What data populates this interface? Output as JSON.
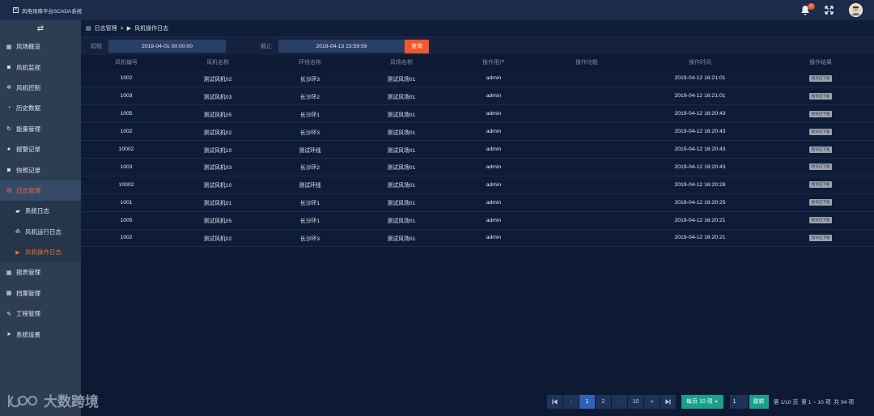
{
  "app": {
    "title": "风电场降平台SCADA系统",
    "notifications": "0"
  },
  "sidebar": {
    "items": [
      {
        "label": "风场概览",
        "icon": "grid-icon",
        "glyph": "▦"
      },
      {
        "label": "风机监视",
        "icon": "camera-icon",
        "glyph": "◙"
      },
      {
        "label": "风机控制",
        "icon": "gear-icon",
        "glyph": "✲"
      },
      {
        "label": "历史数据",
        "icon": "pie-icon",
        "glyph": "◔"
      },
      {
        "label": "能量管理",
        "icon": "refresh-icon",
        "glyph": "↻"
      },
      {
        "label": "报警记录",
        "icon": "bell-icon",
        "glyph": "♠"
      },
      {
        "label": "快照记录",
        "icon": "camera-icon",
        "glyph": "◙"
      },
      {
        "label": "日志管理",
        "icon": "calendar-icon",
        "glyph": "▤"
      }
    ],
    "sub_items": [
      {
        "label": "系统日志",
        "icon": "book-icon",
        "glyph": "▰"
      },
      {
        "label": "风机运行日志",
        "icon": "cubes-icon",
        "glyph": "⁂"
      },
      {
        "label": "风机操作日志",
        "icon": "play-icon",
        "glyph": "▶"
      }
    ],
    "items_after": [
      {
        "label": "报表管理",
        "icon": "grid-icon",
        "glyph": "▦"
      },
      {
        "label": "档案管理",
        "icon": "grid-icon",
        "glyph": "▦"
      },
      {
        "label": "工程管理",
        "icon": "wrench-icon",
        "glyph": "✎"
      },
      {
        "label": "系统设置",
        "icon": "send-icon",
        "glyph": "➤"
      }
    ]
  },
  "breadcrumb": {
    "root": "日志管理",
    "sep": ">",
    "current": "风机操作日志"
  },
  "filter": {
    "start_label": "起始",
    "start_value": "2019-04-01 00:00:00",
    "end_label": "截止",
    "end_value": "2019-04-13 23:59:59",
    "query_label": "查询"
  },
  "table": {
    "columns": [
      "风机编号",
      "风机名称",
      "环线名称",
      "风场名称",
      "操作用户",
      "操作功能",
      "操作时间",
      "操作结果"
    ],
    "rows": [
      [
        "1002",
        "测试风机02",
        "长沙环3",
        "测试风场01",
        "admin",
        "",
        "2019-04-12 16:21:01",
        "指令已下发"
      ],
      [
        "1003",
        "测试风机03",
        "长沙环2",
        "测试风场01",
        "admin",
        "",
        "2019-04-12 16:21:01",
        "指令已下发"
      ],
      [
        "1005",
        "测试风机05",
        "长沙环1",
        "测试风场01",
        "admin",
        "",
        "2019-04-12 16:20:43",
        "指令已下发"
      ],
      [
        "1002",
        "测试风机02",
        "长沙环3",
        "测试风场01",
        "admin",
        "",
        "2019-04-12 16:20:43",
        "指令已下发"
      ],
      [
        "10002",
        "测试风机10",
        "测试环线",
        "测试风场01",
        "admin",
        "",
        "2019-04-12 16:20:43",
        "指令已下发"
      ],
      [
        "1003",
        "测试风机03",
        "长沙环2",
        "测试风场01",
        "admin",
        "",
        "2019-04-12 16:20:43",
        "指令已下发"
      ],
      [
        "10002",
        "测试风机10",
        "测试环线",
        "测试风场01",
        "admin",
        "",
        "2019-04-12 16:20:28",
        "指令已下发"
      ],
      [
        "1001",
        "测试风机01",
        "长沙环1",
        "测试风场01",
        "admin",
        "",
        "2019-04-12 16:20:25",
        "指令已下发"
      ],
      [
        "1005",
        "测试风机05",
        "长沙环1",
        "测试风场01",
        "admin",
        "",
        "2019-04-12 16:20:21",
        "指令已下发"
      ],
      [
        "1002",
        "测试风机02",
        "长沙环3",
        "测试风场01",
        "admin",
        "",
        "2019-04-12 16:20:21",
        "指令已下发"
      ]
    ]
  },
  "pager": {
    "first": "⏮",
    "prev": "‹",
    "pages": [
      "1",
      "2",
      "···",
      "10"
    ],
    "next": "»",
    "last": "⏭",
    "page_size": "每页 10 项",
    "page_input": "1",
    "go": "跳转",
    "info_page": "第 1/10 页",
    "info_range": "第 1 ~ 10 项",
    "info_total": "共 94 项"
  },
  "watermark": {
    "text": "大数跨境"
  }
}
